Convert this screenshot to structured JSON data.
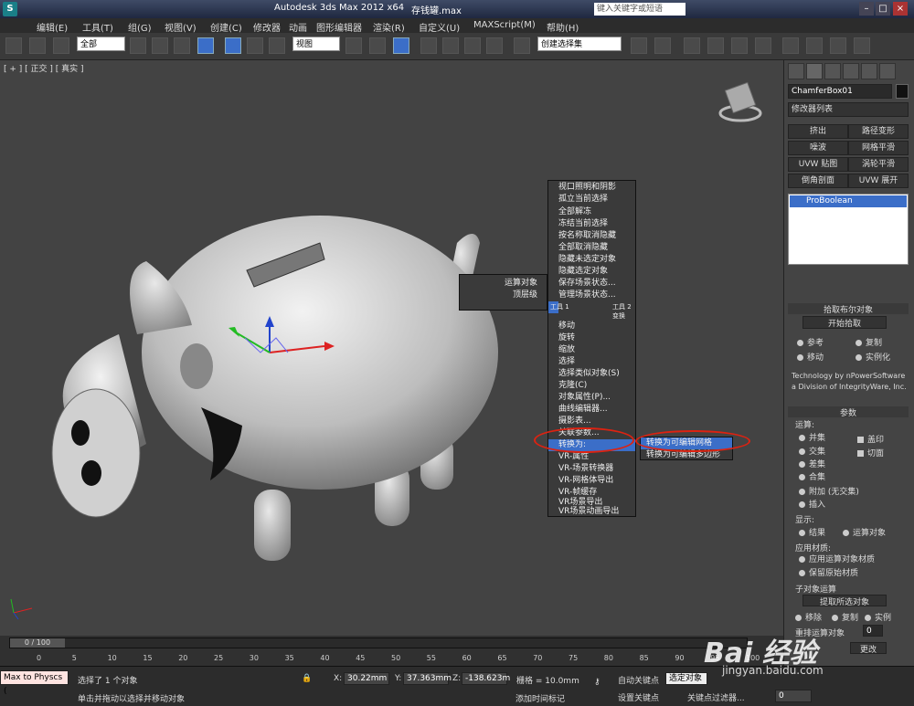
{
  "title": {
    "app": "Autodesk 3ds Max  2012 x64",
    "file": "存钱罐.max",
    "search_placeholder": "键入关键字或短语"
  },
  "menu": [
    "编辑(E)",
    "工具(T)",
    "组(G)",
    "视图(V)",
    "创建(C)",
    "修改器",
    "动画",
    "图形编辑器",
    "渲染(R)",
    "自定义(U)",
    "MAXScript(M)",
    "帮助(H)"
  ],
  "toolbar": {
    "filter": "全部",
    "ref_coord": "视图",
    "selset": "创建选择集"
  },
  "viewport": {
    "label": "[ + ] [ 正交 ] [ 真实 ]"
  },
  "right_panel": {
    "object_name": "ChamferBox01",
    "modifier_list": "修改器列表",
    "mod_buttons": [
      "挤出",
      "路径变形",
      "噪波",
      "网格平滑",
      "UVW 贴图",
      "涡轮平滑",
      "倒角剖面",
      "UVW 展开"
    ],
    "stack_item": "ProBoolean",
    "pick_rollout": {
      "title": "拾取布尔对象",
      "start": "开始拾取",
      "ref": "参考",
      "copy": "复制",
      "move": "移动",
      "instance": "实例化",
      "tech1": "Technology by nPowerSoftware",
      "tech2": "a Division of IntegrityWare, Inc."
    },
    "params": {
      "title": "参数",
      "ops_label": "运算:",
      "union": "并集",
      "intersect": "交集",
      "subtract": "差集",
      "merge": "合集",
      "attach": "附加 (无交集)",
      "insert": "插入",
      "cap": "盖印",
      "cut": "切面",
      "display_label": "显示:",
      "result": "结果",
      "operands": "运算对象",
      "material_label": "应用材质:",
      "apply_op_mat": "应用运算对象材质",
      "keep_orig": "保留原始材质",
      "subop_label": "子对象运算",
      "extract": "提取所选对象",
      "remove": "移除",
      "copy2": "复制",
      "instance2": "实例",
      "reorder": "重排运算对象",
      "reorder_val": "0",
      "change": "更改"
    }
  },
  "context_menu": {
    "items": [
      "视口照明和阴影",
      "孤立当前选择",
      "全部解冻",
      "冻结当前选择",
      "按名称取消隐藏",
      "全部取消隐藏",
      "隐藏未选定对象",
      "隐藏选定对象",
      "保存场景状态...",
      "管理场景状态...",
      "工具 1",
      "工具 2",
      "变换",
      "移动",
      "旋转",
      "缩放",
      "选择",
      "选择类似对象(S)",
      "克隆(C)",
      "对象属性(P)...",
      "曲线编辑器...",
      "摄影表...",
      "关联参数...",
      "转换为:",
      "VR-属性",
      "VR-场景转换器",
      "VR-网格体导出",
      "VR-帧缓存",
      "VR场景导出",
      "VR场景动画导出"
    ],
    "left_items": [
      "运算对象",
      "顶层级"
    ],
    "submenu": [
      "转换为可编辑网格",
      "转换为可编辑多边形"
    ]
  },
  "timeline": {
    "frame": "0 / 100",
    "ticks": [
      "0",
      "5",
      "10",
      "15",
      "20",
      "25",
      "30",
      "35",
      "40",
      "45",
      "50",
      "55",
      "60",
      "65",
      "70",
      "75",
      "80",
      "85",
      "90",
      "95",
      "100"
    ]
  },
  "status": {
    "maxscript": "Max to Physcs (",
    "selected": "选择了 1 个对象",
    "hint": "单击并拖动以选择并移动对象",
    "x_label": "X:",
    "x": "30.22mm",
    "y_label": "Y:",
    "y": "37.363mm",
    "z_label": "Z:",
    "z": "-138.623m",
    "grid": "栅格 = 10.0mm",
    "autokey": "自动关键点",
    "setkey": "设置关键点",
    "selobj": "选定对象",
    "keyfilter": "关键点过滤器...",
    "addtime": "添加时间标记",
    "frame_val": "0"
  },
  "watermark": {
    "logo": "Bai 经验",
    "url": "jingyan.baidu.com"
  }
}
